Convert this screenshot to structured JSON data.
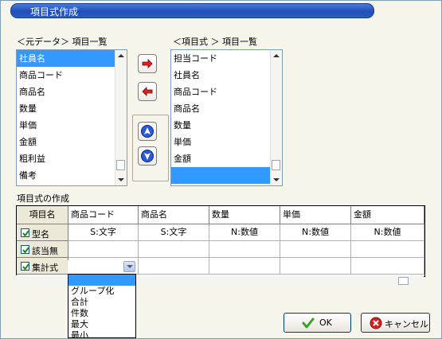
{
  "window": {
    "title": "項目式作成"
  },
  "source": {
    "label": "＜元データ＞ 項目一覧",
    "items": [
      "社員名",
      "商品コード",
      "商品名",
      "数量",
      "単価",
      "金額",
      "粗利益",
      "備考"
    ],
    "selected": 0
  },
  "target": {
    "label": "＜項目式 ＞ 項目一覧",
    "items": [
      "担当コード",
      "社員名",
      "商品コード",
      "商品名",
      "数量",
      "単価",
      "金額",
      ""
    ],
    "selected": 7
  },
  "section_label": "項目式の作成",
  "grid": {
    "corner": "項目名",
    "columns": [
      "商品コード",
      "商品名",
      "数量",
      "単価",
      "金額"
    ],
    "rows": [
      {
        "label": "型名",
        "checked": true,
        "cells": [
          "S:文字",
          "S:文字",
          "N:数値",
          "N:数値",
          "N:数値"
        ]
      },
      {
        "label": "該当無",
        "checked": true,
        "cells": [
          "",
          "",
          "",
          "",
          ""
        ]
      },
      {
        "label": "集計式",
        "checked": true,
        "cells": [
          "",
          "",
          "",
          "",
          ""
        ]
      }
    ]
  },
  "dropdown": {
    "options": [
      "",
      "グループ化",
      "合計",
      "件数",
      "最大",
      "最小"
    ],
    "selected": 0
  },
  "buttons": {
    "ok": "OK",
    "cancel": "キャンセル"
  },
  "colors": {
    "selection": "#3399ff",
    "title_bar": "#2a5cc4"
  }
}
